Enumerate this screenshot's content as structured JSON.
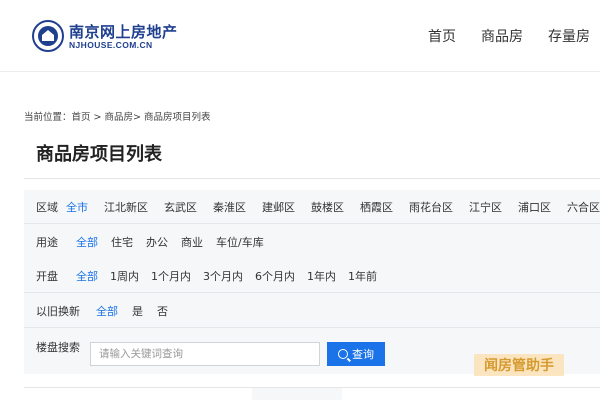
{
  "header": {
    "logo_title": "南京网上房地产",
    "logo_sub": "NJHOUSE.COM.CN",
    "nav": [
      "首页",
      "商品房",
      "存量房"
    ]
  },
  "breadcrumb": {
    "text": "当前位置：首页  >  商品房>  商品房项目列表"
  },
  "page_title": "商品房项目列表",
  "filters": {
    "district": {
      "label": "区域",
      "options": [
        "全市",
        "江北新区",
        "玄武区",
        "秦淮区",
        "建邺区",
        "鼓楼区",
        "栖霞区",
        "雨花台区",
        "江宁区",
        "浦口区",
        "六合区"
      ],
      "active": 0
    },
    "usage": {
      "label": "用途",
      "options": [
        "全部",
        "住宅",
        "办公",
        "商业",
        "车位/车库"
      ],
      "active": 0
    },
    "opening": {
      "label": "开盘",
      "options": [
        "全部",
        "1周内",
        "1个月内",
        "3个月内",
        "6个月内",
        "1年内",
        "1年前"
      ],
      "active": 0
    },
    "trade_in": {
      "label": "以旧换新",
      "options": [
        "全部",
        "是",
        "否"
      ],
      "active": 0
    },
    "search": {
      "label": "楼盘搜索",
      "placeholder": "请输入关键词查询",
      "button": "查询"
    }
  },
  "watermark": "闻房管助手",
  "colors": {
    "accent": "#1a73e8",
    "brand": "#1f3f8f"
  }
}
